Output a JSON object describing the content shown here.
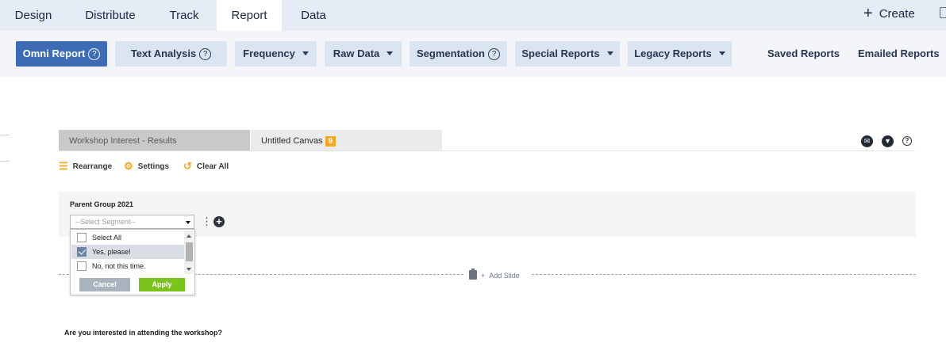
{
  "top_nav": {
    "tabs": [
      {
        "label": "Design"
      },
      {
        "label": "Distribute"
      },
      {
        "label": "Track"
      },
      {
        "label": "Report",
        "active": true
      },
      {
        "label": "Data"
      }
    ],
    "create_label": "Create"
  },
  "toolbar": {
    "omni_report": "Omni Report",
    "text_analysis": "Text Analysis",
    "frequency": "Frequency",
    "raw_data": "Raw Data",
    "segmentation": "Segmentation",
    "special_reports": "Special Reports",
    "legacy_reports": "Legacy Reports",
    "saved_reports": "Saved Reports",
    "emailed_reports": "Emailed Reports",
    "help_glyph": "?"
  },
  "canvas_tabs": {
    "tab1": "Workshop Interest - Results",
    "tab2": "Untitled Canvas",
    "tab2_badge": "9"
  },
  "actions": {
    "rearrange": "Rearrange",
    "settings": "Settings",
    "clear_all": "Clear All"
  },
  "segment": {
    "group_title": "Parent Group 2021",
    "select_placeholder": "--Select Segment--",
    "options": [
      {
        "label": "Select All",
        "checked": false
      },
      {
        "label": "Yes, please!",
        "checked": true
      },
      {
        "label": "No, not this time.",
        "checked": false
      }
    ],
    "cancel": "Cancel",
    "apply": "Apply"
  },
  "add_slide": "Add Slide",
  "question": "Are you interested in attending the workshop?",
  "colors": {
    "primary": "#3d6bb5",
    "apply_green": "#7bc41f",
    "accent_orange": "#f5a623",
    "nav_bg": "#e6ecf5"
  },
  "icons": [
    "plus-icon",
    "help-icon",
    "caret-down-icon",
    "mail-icon",
    "download-icon",
    "rearrange-icon",
    "gear-icon",
    "reset-icon",
    "kebab-icon",
    "clipboard-icon",
    "checkbox-icon"
  ]
}
